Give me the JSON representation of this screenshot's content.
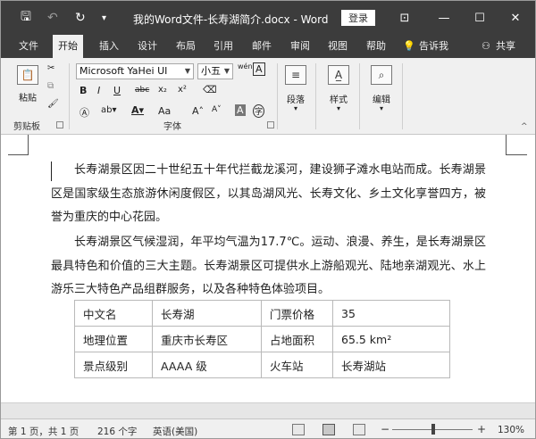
{
  "titlebar": {
    "title": "我的Word文件-长寿湖简介.docx  -  Word",
    "login": "登录",
    "save_glyph": "🖫",
    "undo_glyph": "↶",
    "redo_glyph": "↻",
    "customize_glyph": "▾",
    "ribbon_display_glyph": "⊡",
    "minimize_glyph": "—",
    "maximize_glyph": "☐",
    "close_glyph": "✕"
  },
  "tabs": [
    {
      "label": "文件"
    },
    {
      "label": "开始"
    },
    {
      "label": "插入"
    },
    {
      "label": "设计"
    },
    {
      "label": "布局"
    },
    {
      "label": "引用"
    },
    {
      "label": "邮件"
    },
    {
      "label": "审阅"
    },
    {
      "label": "视图"
    },
    {
      "label": "帮助"
    },
    {
      "label": "告诉我"
    },
    {
      "label": "共享"
    }
  ],
  "ribbon": {
    "clipboard": {
      "paste": "粘贴",
      "label": "剪贴板"
    },
    "font": {
      "family": "Microsoft YaHei UI",
      "size": "小五",
      "bold": "B",
      "italic": "I",
      "underline": "U",
      "strike": "abc",
      "subscript": "x₂",
      "superscript": "x²",
      "grow": "A˄",
      "shrink": "A˅",
      "case": "Aa",
      "phonetic": "wén",
      "border_char": "A",
      "shade_char": "A",
      "enclose_char": "字",
      "label": "字体"
    },
    "paragraph": {
      "label": "段落"
    },
    "styles": {
      "label": "样式"
    },
    "editing": {
      "label": "编辑"
    }
  },
  "document": {
    "paragraphs": [
      "长寿湖景区因二十世纪五十年代拦截龙溪河，建设狮子滩水电站而成。长寿湖景区是国家级生态旅游休闲度假区，以其岛湖风光、长寿文化、乡土文化享誉四方，被誉为重庆的中心花园。",
      "长寿湖景区气候湿润，年平均气温为17.7℃。运动、浪漫、养生，是长寿湖景区最具特色和价值的三大主题。长寿湖景区可提供水上游船观光、陆地亲湖观光、水上游乐三大特色产品组群服务，以及各种特色体验项目。"
    ],
    "table": [
      [
        "中文名",
        "长寿湖",
        "门票价格",
        "35"
      ],
      [
        "地理位置",
        "重庆市长寿区",
        "占地面积",
        "65.5 km²"
      ],
      [
        "景点级别",
        "AAAA 级",
        "火车站",
        "长寿湖站"
      ]
    ]
  },
  "statusbar": {
    "page": "第 1 页，共 1 页",
    "words": "216 个字",
    "language": "英语(美国)",
    "zoom_out": "−",
    "zoom_in": "+",
    "zoom": "130%"
  }
}
